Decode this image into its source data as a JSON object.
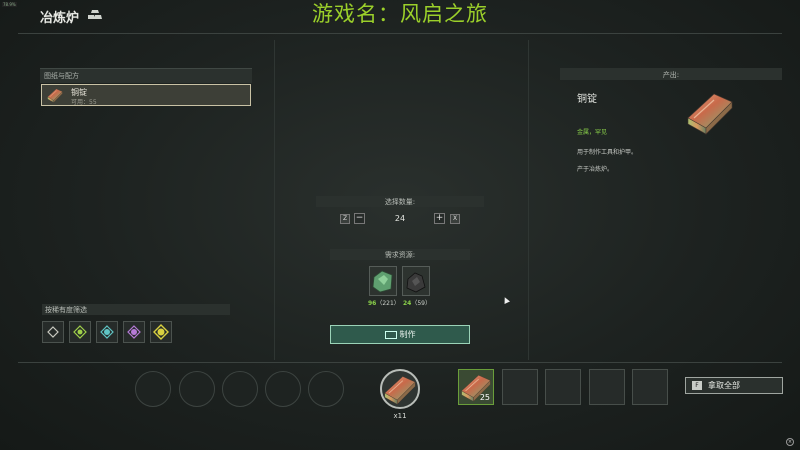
{
  "overlay": {
    "fps": "78.9%"
  },
  "window": {
    "title": "冶炼炉",
    "game_name": "游戏名：风启之旅"
  },
  "recipes": {
    "section_label": "图纸与配方",
    "items": [
      {
        "name": "铜锭",
        "availability": "可用：55"
      }
    ]
  },
  "output": {
    "section_label": "产出:",
    "name": "铜锭",
    "category": "金属，罕见",
    "description": "用于制作工具和护甲。",
    "source": "产于冶炼炉。"
  },
  "quantity": {
    "section_label": "选择数量:",
    "decrease_key": "Z",
    "increase_key": "X",
    "minus": "−",
    "plus": "+",
    "value": "24"
  },
  "requirements": {
    "section_label": "需求资源:",
    "items": [
      {
        "icon": "copper-ore-icon",
        "needed": "96",
        "owned": "（221）"
      },
      {
        "icon": "coal-icon",
        "needed": "24",
        "owned": "（59）"
      }
    ]
  },
  "craft": {
    "label": "制作"
  },
  "filters": {
    "section_label": "按稀有度筛选",
    "items": [
      {
        "icon": "common-rarity-icon",
        "color": "#c9c9c0"
      },
      {
        "icon": "uncommon-rarity-icon",
        "color": "#9fd04a"
      },
      {
        "icon": "rare-rarity-icon",
        "color": "#5fc4c4"
      },
      {
        "icon": "epic-rarity-icon",
        "color": "#b57ad6"
      },
      {
        "icon": "legendary-rarity-icon",
        "color": "#d8d040"
      }
    ]
  },
  "queue": {
    "active_count": "x11"
  },
  "output_slots": {
    "first_count": "25"
  },
  "take_all": {
    "key": "F",
    "label": "拿取全部"
  }
}
